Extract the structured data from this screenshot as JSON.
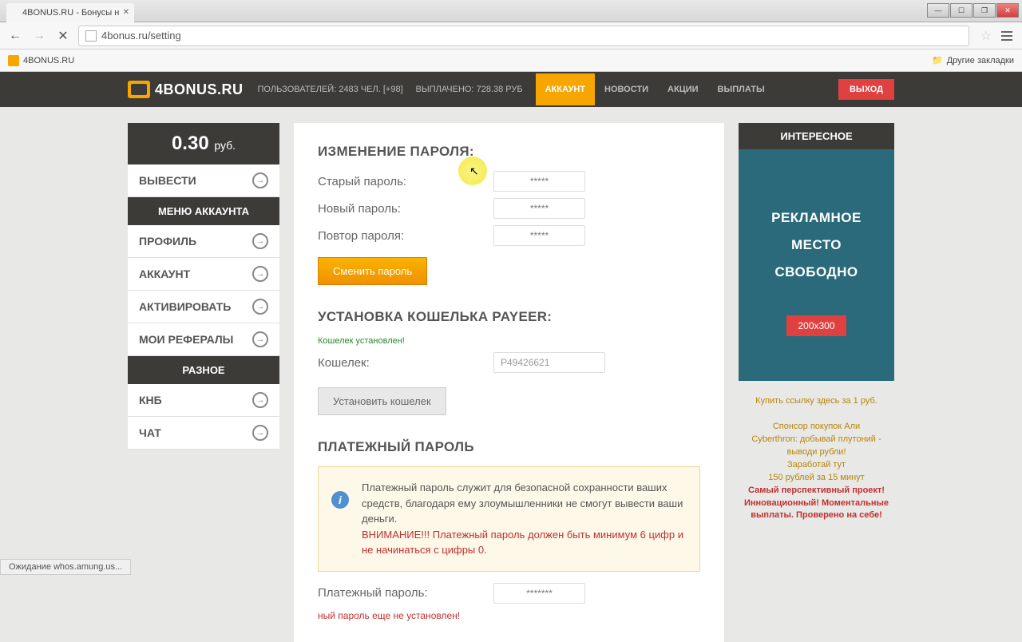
{
  "browser": {
    "tab_title": "4BONUS.RU - Бонусы н",
    "url": "4bonus.ru/setting",
    "bookmark_1": "4BONUS.RU",
    "other_bookmarks": "Другие закладки",
    "status_text": "Ожидание whos.amung.us..."
  },
  "header": {
    "logo": "4BONUS.RU",
    "users_stat": "ПОЛЬЗОВАТЕЛЕЙ: 2483 ЧЕЛ. [+98]",
    "paid_stat": "ВЫПЛАЧЕНО: 728.38 РУБ",
    "nav": {
      "account": "АККАУНТ",
      "news": "НОВОСТИ",
      "promo": "АКЦИИ",
      "payouts": "ВЫПЛАТЫ"
    },
    "logout": "ВЫХОД"
  },
  "sidebar": {
    "balance_value": "0.30",
    "balance_currency": "руб.",
    "withdraw": "ВЫВЕСТИ",
    "menu_header_1": "МЕНЮ АККАУНТА",
    "items": {
      "profile": "ПРОФИЛЬ",
      "account": "АККАУНТ",
      "activate": "АКТИВИРОВАТЬ",
      "referrals": "МОИ РЕФЕРАЛЫ"
    },
    "menu_header_2": "РАЗНОЕ",
    "items2": {
      "knb": "КНБ",
      "chat": "ЧАТ"
    }
  },
  "main": {
    "password_section": {
      "title": "ИЗМЕНЕНИЕ ПАРОЛЯ:",
      "old_password": "Старый пароль:",
      "new_password": "Новый пароль:",
      "repeat_password": "Повтор пароля:",
      "placeholder": "*****",
      "submit": "Сменить пароль"
    },
    "wallet_section": {
      "title": "УСТАНОВКА КОШЕЛЬКА PAYEER:",
      "success": "Кошелек установлен!",
      "wallet_label": "Кошелек:",
      "wallet_value": "P49426621",
      "submit": "Установить кошелек"
    },
    "payment_section": {
      "title": "ПЛАТЕЖНЫЙ ПАРОЛЬ",
      "info_text": "Платежный пароль служит для безопасной сохранности ваших средств, благодаря ему злоумышленники не смогут вывести ваши деньги.",
      "warning": "ВНИМАНИЕ!!! Платежный пароль должен быть минимум 6 цифр и не начинаться с цифры 0.",
      "field_label": "Платежный пароль:",
      "placeholder": "*******",
      "not_set": "ный пароль еще не установлен!"
    }
  },
  "ads": {
    "header": "ИНТЕРЕСНОЕ",
    "line1": "РЕКЛАМНОЕ",
    "line2": "МЕСТО",
    "line3": "СВОБОДНО",
    "size": "200x300",
    "link1": "Купить ссылку здесь за 1 руб.",
    "link2": "Спонсор покупок Али",
    "link3": "Cyberthron: добывай плутоний - выводи рубли!",
    "link4": "Заработай тут",
    "link5": "150 рублей за 15 минут",
    "link6": "Самый перспективный проект! Инновационный! Моментальные выплаты. Проверено на себе!"
  }
}
